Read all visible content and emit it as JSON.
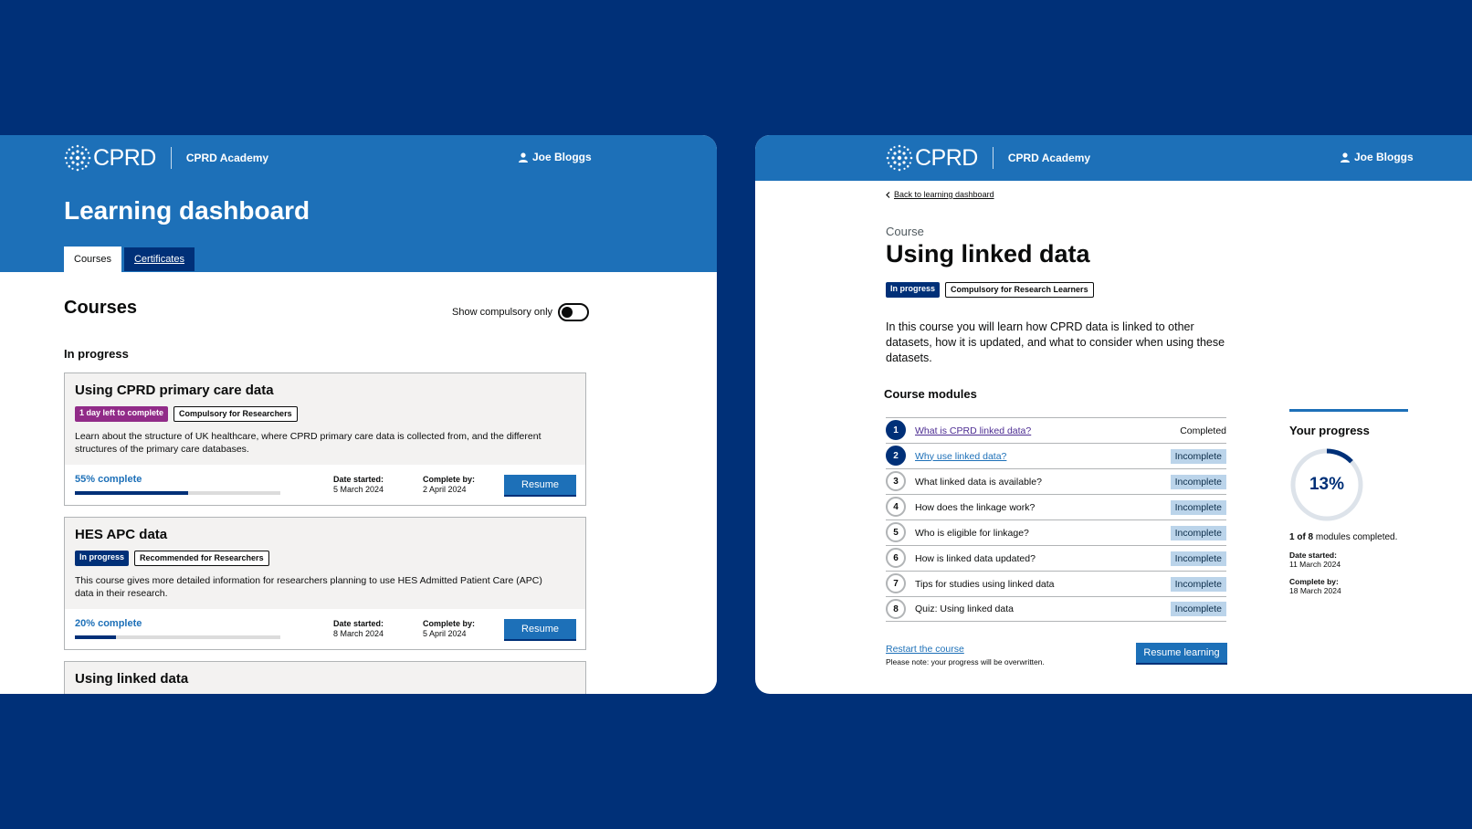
{
  "brand": {
    "logo_text": "CPRD",
    "academy": "CPRD Academy",
    "user_name": "Joe Bloggs",
    "colors": {
      "background": "#003078",
      "primary": "#1d70b8",
      "dark_blue": "#003078",
      "purple": "#912b88",
      "pill": "#bbd4ea"
    }
  },
  "dashboard": {
    "title": "Learning dashboard",
    "tabs": [
      {
        "label": "Courses",
        "active": true
      },
      {
        "label": "Certificates",
        "active": false
      }
    ],
    "courses_heading": "Courses",
    "toggle_label": "Show compulsory only",
    "toggle_on": false,
    "section_label": "In progress",
    "cards": [
      {
        "title": "Using CPRD primary care data",
        "tags": [
          "1 day left to complete",
          "Compulsory for Researchers"
        ],
        "description": "Learn about the structure of UK healthcare, where CPRD primary care data is collected from, and the different structures of the primary care databases.",
        "progress_label": "55% complete",
        "progress": 0.55,
        "date_started_label": "Date started:",
        "date_started": "5 March 2024",
        "complete_by_label": "Complete by:",
        "complete_by": "2 April 2024",
        "button": "Resume"
      },
      {
        "title": "HES APC data",
        "tags": [
          "In progress",
          "Recommended for Researchers"
        ],
        "description": "This course gives more detailed information for researchers planning to use HES Admitted Patient Care (APC) data in their research.",
        "progress_label": "20% complete",
        "progress": 0.2,
        "date_started_label": "Date started:",
        "date_started": "8 March 2024",
        "complete_by_label": "Complete by:",
        "complete_by": "5 April 2024",
        "button": "Resume"
      },
      {
        "title": "Using linked data"
      }
    ]
  },
  "course": {
    "back_link": "Back to learning dashboard",
    "caption": "Course",
    "title": "Using linked data",
    "tags": [
      "In progress",
      "Compulsory for Research Learners"
    ],
    "intro": "In this course you will learn how CPRD data is linked to other datasets, how it is updated, and what to consider when using these datasets.",
    "modules_heading": "Course modules",
    "modules": [
      {
        "num": "1",
        "label": "What is CPRD linked data?",
        "status": "Completed"
      },
      {
        "num": "2",
        "label": "Why use linked data?",
        "status": "Incomplete"
      },
      {
        "num": "3",
        "label": "What linked data is available?",
        "status": "Incomplete"
      },
      {
        "num": "4",
        "label": "How does the linkage work?",
        "status": "Incomplete"
      },
      {
        "num": "5",
        "label": "Who is eligible for linkage?",
        "status": "Incomplete"
      },
      {
        "num": "6",
        "label": "How is linked data updated?",
        "status": "Incomplete"
      },
      {
        "num": "7",
        "label": "Tips for studies using linked data",
        "status": "Incomplete"
      },
      {
        "num": "8",
        "label": "Quiz: Using linked data",
        "status": "Incomplete"
      }
    ],
    "restart": "Restart the course",
    "note": "Please note: your progress will be overwritten.",
    "resume_button": "Resume learning",
    "progress": {
      "heading": "Your progress",
      "percent_label": "13%",
      "percent": 0.13,
      "done_count": "1 of 8",
      "done_suffix": " modules completed.",
      "date_started_label": "Date started:",
      "date_started": "11 March 2024",
      "complete_by_label": "Complete by:",
      "complete_by": "18 March 2024"
    }
  }
}
